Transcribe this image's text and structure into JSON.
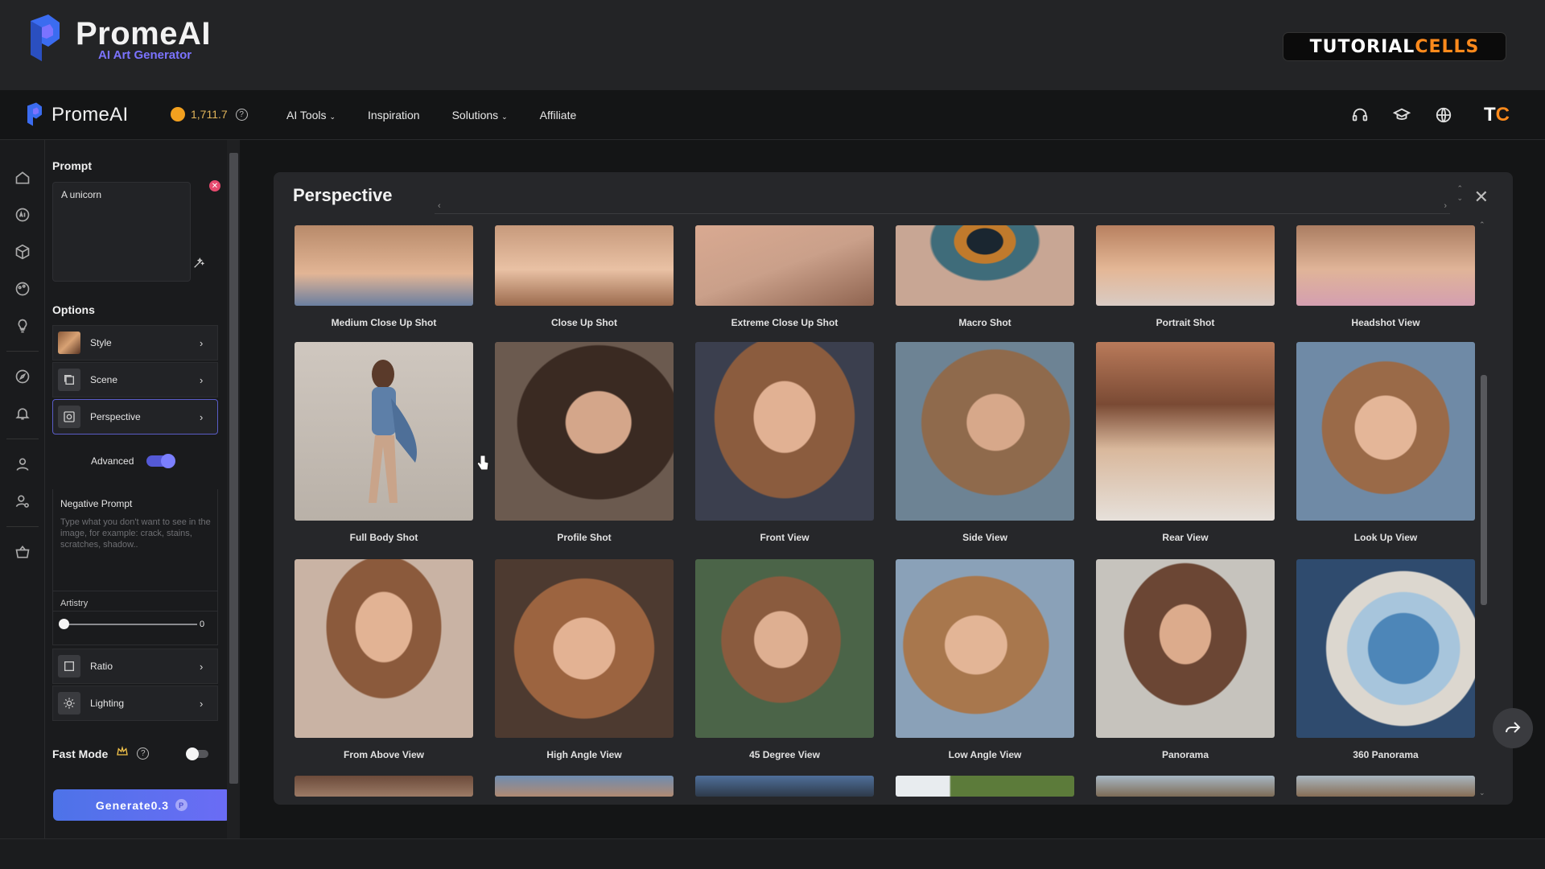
{
  "banner": {
    "brand_name": "PromeAI",
    "brand_sub": "AI Art Generator",
    "tc_part1": "TUTORIAL",
    "tc_part2": "CELLS"
  },
  "navbar": {
    "logo": "PromeAI",
    "credits": "1,711.7",
    "menu": [
      "AI Tools",
      "Inspiration",
      "Solutions",
      "Affiliate"
    ],
    "avatar_a": "T",
    "avatar_b": "C"
  },
  "panel": {
    "prompt_title": "Prompt",
    "prompt_value": "A unicorn",
    "options_title": "Options",
    "options": [
      {
        "label": "Style"
      },
      {
        "label": "Scene"
      },
      {
        "label": "Perspective"
      }
    ],
    "advanced_label": "Advanced",
    "negative_title": "Negative Prompt",
    "negative_placeholder": "Type what you don't want to see in the image, for example: crack, stains, scratches, shadow..",
    "artistry_label": "Artistry",
    "artistry_value": "0",
    "ratio_label": "Ratio",
    "lighting_label": "Lighting",
    "fast_mode_label": "Fast Mode",
    "generate_label": "Generate0.3"
  },
  "modal": {
    "title": "Perspective",
    "rows": [
      [
        "Medium Close Up Shot",
        "Close Up Shot",
        "Extreme Close Up Shot",
        "Macro Shot",
        "Portrait Shot",
        "Headshot View"
      ],
      [
        "Full Body Shot",
        "Profile Shot",
        "Front View",
        "Side View",
        "Rear View",
        "Look Up View"
      ],
      [
        "From Above View",
        "High Angle View",
        "45 Degree View",
        "Low Angle View",
        "Panorama",
        "360 Panorama"
      ]
    ]
  },
  "colors": {
    "accent": "#5459d6",
    "generate_start": "#4d73e8",
    "generate_end": "#6b6cf5",
    "credit_gold": "#f3a11f"
  }
}
